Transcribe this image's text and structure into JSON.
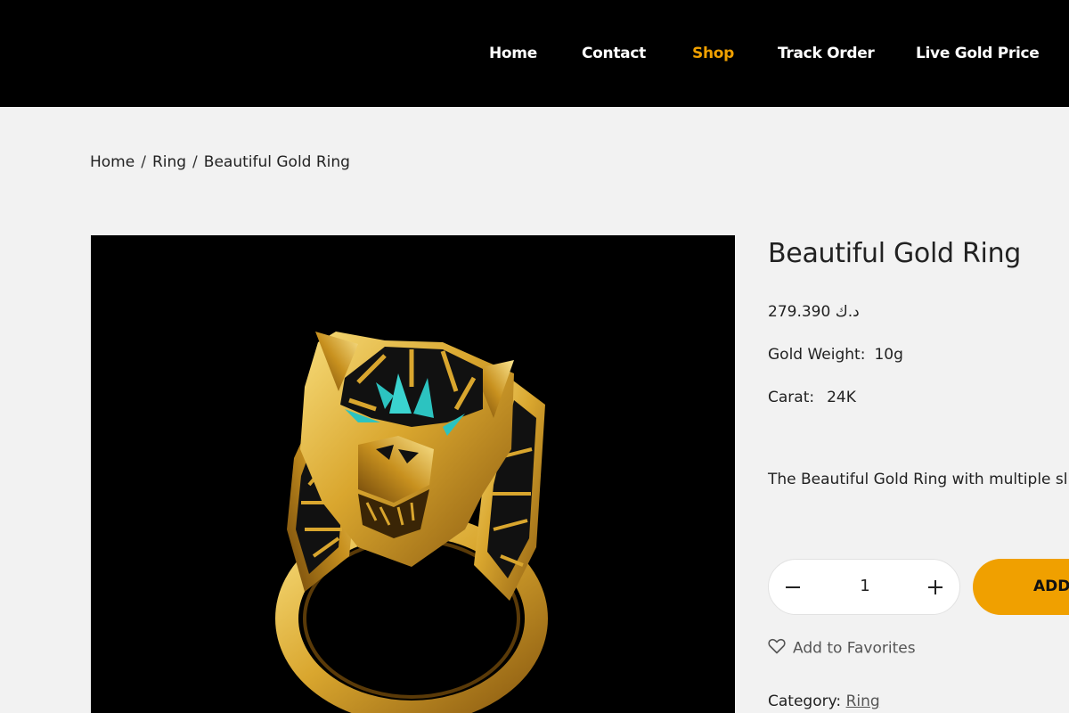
{
  "nav": {
    "items": [
      "Home",
      "Contact",
      "Shop",
      "Track Order",
      "Live Gold Price"
    ],
    "active_index": 2,
    "active_color": "#f0a000"
  },
  "breadcrumb": {
    "items": [
      "Home",
      "Ring",
      "Beautiful Gold Ring"
    ],
    "separator": "/"
  },
  "product": {
    "title": "Beautiful Gold Ring",
    "price": "279.390 د.ك",
    "gold_weight_label": "Gold Weight:",
    "gold_weight_value": "10g",
    "carat_label": "Carat:",
    "carat_value": "24K",
    "description": "The Beautiful Gold Ring with multiple sl",
    "quantity": "1",
    "minus_icon": "minus-icon",
    "plus_icon": "plus-icon",
    "add_to_cart_label": "ADD",
    "favorites_label": "Add to Favorites",
    "favorites_icon": "heart-icon",
    "category_label": "Category:",
    "category_value": "Ring"
  },
  "colors": {
    "header_bg": "#000000",
    "page_bg": "#f2f2f2",
    "accent": "#f0a000"
  }
}
